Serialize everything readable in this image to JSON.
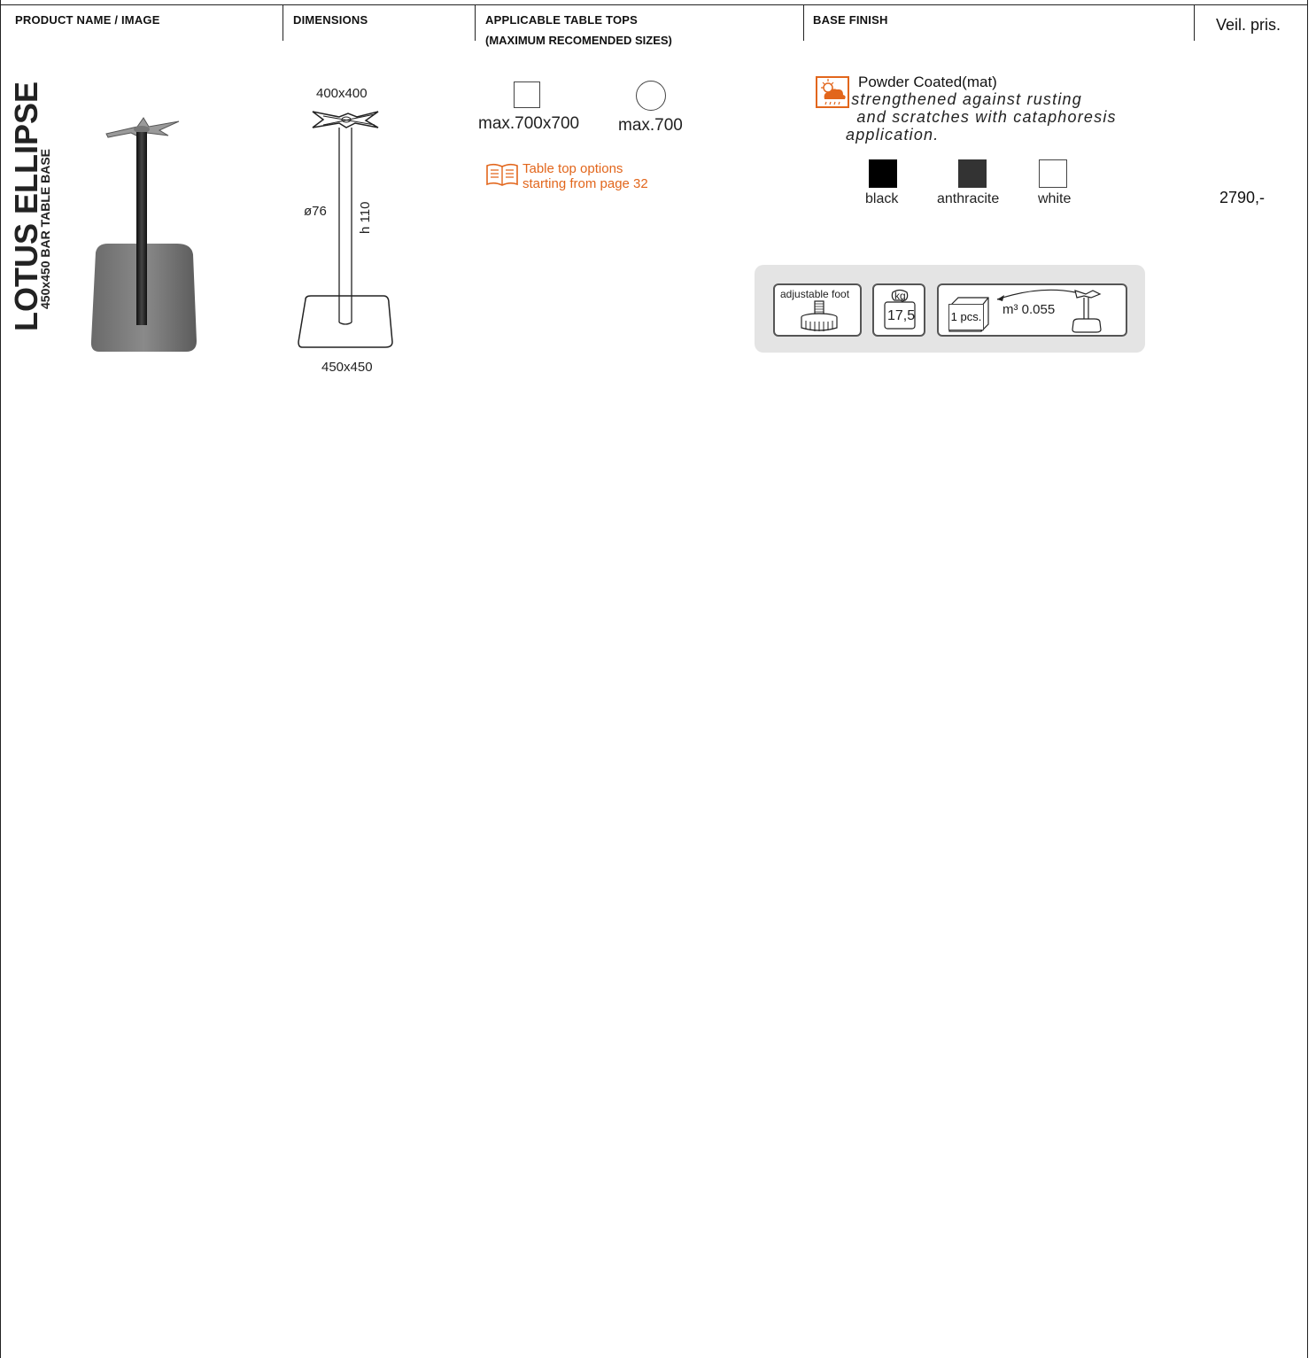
{
  "headers": {
    "product": "PRODUCT NAME / IMAGE",
    "dimensions": "DIMENSIONS",
    "tops_line1": "APPLICABLE TABLE TOPS",
    "tops_line2": "(MAXIMUM RECOMENDED SIZES)",
    "finish": "BASE FINISH",
    "price": "Veil. pris."
  },
  "product": {
    "name": "LOTUS ELLIPSE",
    "subtitle": "450x450 BAR TABLE BASE"
  },
  "dimensions": {
    "top_plate": "400x400",
    "diameter": "ø76",
    "height": "h 110",
    "base": "450x450"
  },
  "table_tops": {
    "square_max": "max.700x700",
    "round_max": "max.700",
    "options_line1": "Table top options",
    "options_line2": "starting from page 32"
  },
  "finish": {
    "title": "Powder Coated(mat)",
    "description": " strengthened against rusting\n  and scratches with cataphoresis\napplication.",
    "colors": [
      {
        "label": "black",
        "hex": "#000000"
      },
      {
        "label": "anthracite",
        "hex": "#333333"
      },
      {
        "label": "white",
        "hex": "#ffffff"
      }
    ]
  },
  "info": {
    "adjustable_foot": "adjustable foot",
    "kg_label": "kg",
    "weight": "17,5",
    "pieces": "1 pcs.",
    "volume": "m³ 0.055"
  },
  "price": "2790,-",
  "accent": "#e2661c"
}
